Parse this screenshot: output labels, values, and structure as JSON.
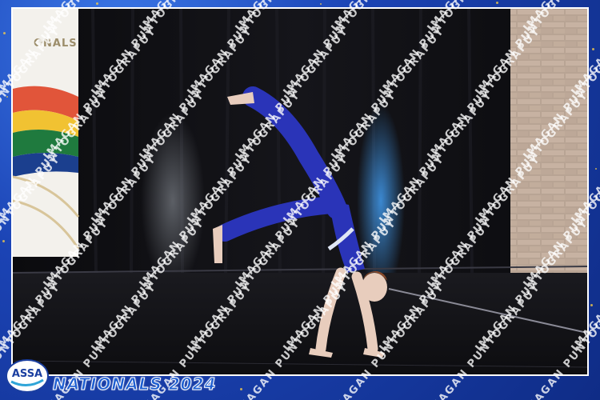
{
  "photo": {
    "banner_text": "ONALS",
    "watermark_text": "IMAGAN PUNTOGRAPUY"
  },
  "footer": {
    "logo_text": "ASSA",
    "event_title": "NATIONALS 2024"
  },
  "colors": {
    "frame_blue": "#1b43b4",
    "sparkle_gold": "#f3c94a",
    "costume_blue": "#2a34b8",
    "title_blue": "#1e5fd1"
  }
}
